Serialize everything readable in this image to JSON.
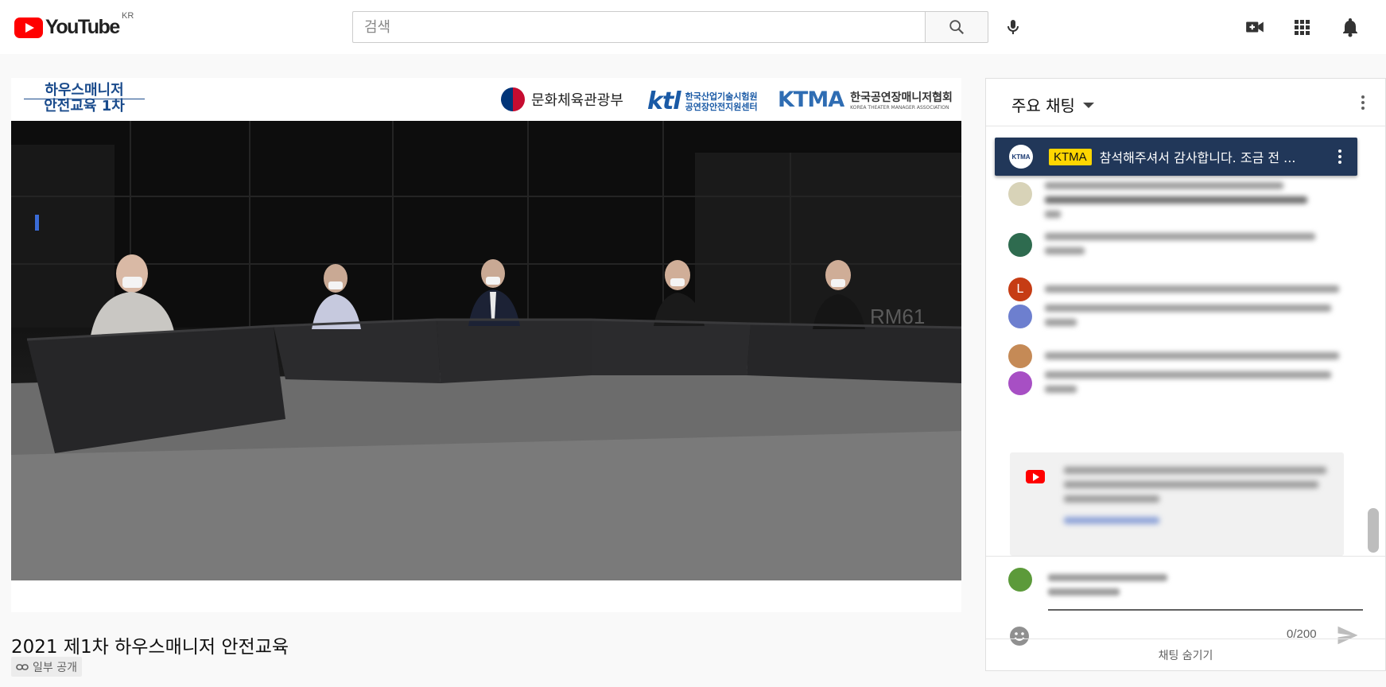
{
  "masthead": {
    "logo_text": "YouTube",
    "country_code": "KR",
    "search_placeholder": "검색",
    "icons": [
      "search-icon",
      "mic-icon",
      "create-video-icon",
      "apps-grid-icon",
      "notifications-bell-icon"
    ]
  },
  "video": {
    "banner_title_line1": "하우스매니저",
    "banner_title_line2": "안전교육 1차",
    "sponsor_moc": "문화체육관광부",
    "sponsor_ktl_mark": "ktl",
    "sponsor_ktl_line1": "한국산업기술시험원",
    "sponsor_ktl_line2": "공연장안전지원센터",
    "sponsor_ktma_mark": "KTMA",
    "sponsor_ktma_ko": "한국공연장매니저협회",
    "sponsor_ktma_en": "KOREA THEATER MANAGER ASSOCIATION",
    "title": "2021 제1차 하우스매니저 안전교육",
    "privacy": "일부 공개"
  },
  "chat": {
    "mode_label": "주요 채팅",
    "pinned": {
      "avatar_text": "KTMA",
      "author_badge": "KTMA",
      "text": "참석해주셔서 감사합니다. 조금 전 ..."
    },
    "avatar_letter": "L",
    "counter": "0/200",
    "hide_label": "채팅 숨기기"
  },
  "colors": {
    "youtube_red": "#ff0000",
    "pinned_bg": "#213759",
    "owner_badge": "#ffd600"
  }
}
